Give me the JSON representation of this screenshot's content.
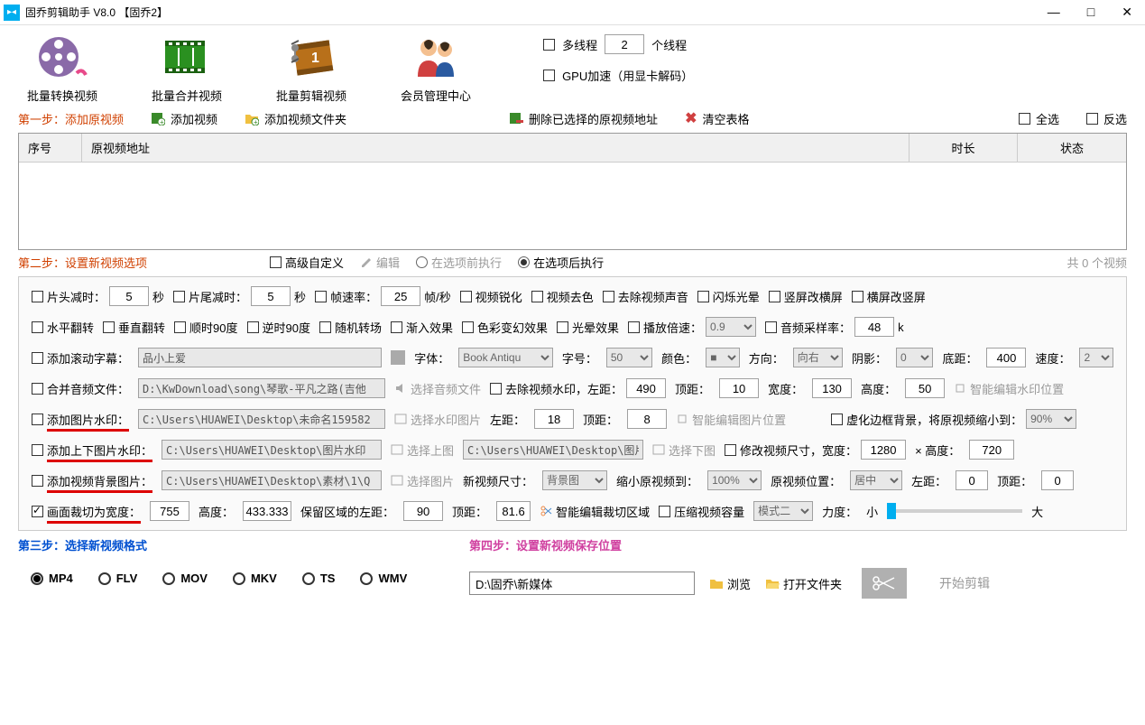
{
  "titlebar": {
    "title": "固乔剪辑助手 V8.0  【固乔2】"
  },
  "toolbar": {
    "items": [
      {
        "label": "批量转换视频"
      },
      {
        "label": "批量合并视频"
      },
      {
        "label": "批量剪辑视频"
      },
      {
        "label": "会员管理中心"
      }
    ],
    "multithread": {
      "label": "多线程",
      "value": "2",
      "suffix": "个线程"
    },
    "gpu": {
      "label": "GPU加速（用显卡解码）"
    }
  },
  "step1": {
    "title": "第一步：添加原视频",
    "add_video": "添加视频",
    "add_folder": "添加视频文件夹",
    "delete_sel": "删除已选择的原视频地址",
    "clear": "清空表格",
    "select_all": "全选",
    "invert": "反选",
    "cols": {
      "idx": "序号",
      "path": "原视频地址",
      "duration": "时长",
      "status": "状态"
    }
  },
  "step2": {
    "title": "第二步：设置新视频选项",
    "advanced": "高级自定义",
    "edit": "编辑",
    "before": "在选项前执行",
    "after": "在选项后执行",
    "total": "共 0 个视频"
  },
  "opts": {
    "head_cut": "片头减时：",
    "head_val": "5",
    "sec": "秒",
    "tail_cut": "片尾减时：",
    "tail_val": "5",
    "fps": "帧速率：",
    "fps_val": "25",
    "fps_unit": "帧/秒",
    "sharpen": "视频锐化",
    "desat": "视频去色",
    "mute": "去除视频声音",
    "flash": "闪烁光晕",
    "v2h": "竖屏改横屏",
    "h2v": "横屏改竖屏",
    "hflip": "水平翻转",
    "vflip": "垂直翻转",
    "cw90": "顺时90度",
    "ccw90": "逆时90度",
    "rand_trans": "随机转场",
    "fade": "渐入效果",
    "color_fx": "色彩变幻效果",
    "glow": "光晕效果",
    "speed": "播放倍速：",
    "speed_val": "0.9",
    "audio_sr": "音频采样率：",
    "audio_sr_val": "48",
    "audio_sr_unit": "k",
    "scroll_text": "添加滚动字幕：",
    "scroll_val": "品小上爱",
    "font": "字体：",
    "font_val": "Book Antiqu",
    "font_size": "字号：",
    "font_size_val": "50",
    "font_color": "颜色：",
    "direction": "方向：",
    "direction_val": "向右",
    "shadow": "阴影：",
    "shadow_val": "0",
    "baseline": "底距：",
    "baseline_val": "400",
    "scroll_speed": "速度：",
    "scroll_speed_val": "2",
    "merge_audio": "合并音频文件：",
    "merge_audio_val": "D:\\KwDownload\\song\\琴歌-平凡之路(吉他",
    "select_audio": "选择音频文件",
    "remove_wm": "去除视频水印，左距：",
    "wm_left": "490",
    "wm_top_l": "顶距：",
    "wm_top": "10",
    "wm_w_l": "宽度：",
    "wm_w": "130",
    "wm_h_l": "高度：",
    "wm_h": "50",
    "smart_wm": "智能编辑水印位置",
    "img_wm": "添加图片水印：",
    "img_wm_val": "C:\\Users\\HUAWEI\\Desktop\\未命名159582",
    "sel_wm_img": "选择水印图片",
    "iw_left_l": "左距：",
    "iw_left": "18",
    "iw_top_l": "顶距：",
    "iw_top": "8",
    "smart_img": "智能编辑图片位置",
    "blur_border": "虚化边框背景，将原视频缩小到：",
    "blur_pct": "90%",
    "tb_wm": "添加上下图片水印：",
    "tb_wm_val": "C:\\Users\\HUAWEI\\Desktop\\图片水印",
    "sel_top": "选择上图",
    "tb_wm_val2": "C:\\Users\\HUAWEI\\Desktop\\图片",
    "sel_bot": "选择下图",
    "resize": "修改视频尺寸，宽度：",
    "rw": "1280",
    "times": "× 高度：",
    "rh": "720",
    "bg_img": "添加视频背景图片：",
    "bg_img_val": "C:\\Users\\HUAWEI\\Desktop\\素材\\1\\Q",
    "sel_img": "选择图片",
    "new_size": "新视频尺寸：",
    "bg_opt": "背景图",
    "shrink": "缩小原视频到：",
    "shrink_val": "100%",
    "orig_pos": "原视频位置：",
    "orig_pos_val": "居中",
    "pos_left_l": "左距：",
    "pos_left": "0",
    "pos_top_l": "顶距：",
    "pos_top": "0",
    "crop": "画面裁切为宽度：",
    "crop_w": "755",
    "crop_h_l": "高度：",
    "crop_h": "433.333",
    "crop_keep_l": "保留区域的左距：",
    "crop_left": "90",
    "crop_top_l": "顶距：",
    "crop_top": "81.6",
    "smart_crop": "智能编辑裁切区域",
    "compress": "压缩视频容量",
    "compress_mode": "模式二",
    "strength": "力度：",
    "small": "小",
    "big": "大"
  },
  "step3": {
    "title": "第三步：选择新视频格式",
    "formats": [
      "MP4",
      "FLV",
      "MOV",
      "MKV",
      "TS",
      "WMV"
    ]
  },
  "step4": {
    "title": "第四步：设置新视频保存位置",
    "path": "D:\\固乔\\新媒体",
    "browse": "浏览",
    "open": "打开文件夹",
    "start": "开始剪辑"
  }
}
